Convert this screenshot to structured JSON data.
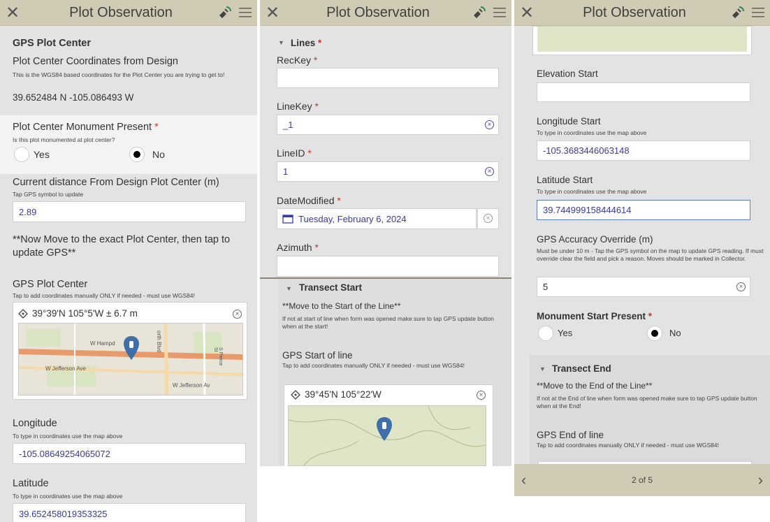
{
  "header": {
    "title": "Plot Observation"
  },
  "panel1": {
    "section_title": "GPS Plot Center",
    "design_label": "Plot Center Coordinates from Design",
    "design_help": "This is the WGS84 based coordinates for the Plot Center you are trying to get to!",
    "design_value": "39.652484 N -105.086493 W",
    "monument_label": "Plot Center Monument Present",
    "monument_help": "Is this plot monumented at plot center?",
    "monument_yes": "Yes",
    "monument_no": "No",
    "distance_label": "Current distance From Design Plot Center (m)",
    "distance_help": "Tap GPS symbol to update",
    "distance_value": "2.89",
    "instruction": "**Now Move to the exact Plot Center, then tap to update GPS**",
    "gps_label": "GPS Plot Center",
    "gps_help": "Tap to add coordinates manually ONLY if needed - must use WGS84!",
    "gps_value": "39°39'N 105°5'W ± 6.7 m",
    "map_labels": {
      "road1": "W Hampd",
      "road2": "W Jefferson Ave",
      "road3": "W Jefferson Av",
      "road4": "orth Blvd",
      "road5": "S Pierce St"
    },
    "longitude_label": "Longitude",
    "longitude_help": "To type in coordinates use the map above",
    "longitude_value": "-105.08649254065072",
    "latitude_label": "Latitude",
    "latitude_help": "To type in coordinates use the map above",
    "latitude_value": "39.652458019353325"
  },
  "panel2": {
    "lines_title": "Lines",
    "reckey_label": "RecKey",
    "reckey_value": "",
    "linekey_label": "LineKey",
    "linekey_value": "_1",
    "lineid_label": "LineID",
    "lineid_value": "1",
    "date_label": "DateModified",
    "date_value": "Tuesday, February 6, 2024",
    "azimuth_label": "Azimuth",
    "azimuth_value": "",
    "transect_title": "Transect Start",
    "move_text": "**Move to the Start of the Line**",
    "move_help": "If not at start of line when form was opened make sure to tap GPS update button when at the start!",
    "gps_start_label": "GPS Start of line",
    "gps_start_help": "Tap to add coordinates manually ONLY if needed - must use WGS84!",
    "gps_start_value": "39°45'N 105°22'W"
  },
  "panel3": {
    "elev_label": "Elevation Start",
    "elev_value": "",
    "lon_label": "Longitude Start",
    "lon_help": "To type in coordinates use the map above",
    "lon_value": "-105.3683446063148",
    "lat_label": "Latitude Start",
    "lat_help": "To type in coordinates use the map above",
    "lat_value": "39.744999158444614",
    "acc_label": "GPS Accuracy Override (m)",
    "acc_help": "Must be under 10 m - Tap the GPS symbol on the map to update GPS reading. If must override clear the field and pick a reason. Moves should be marked in Collector.",
    "acc_value": "5",
    "mon_label": "Monument Start Present",
    "mon_yes": "Yes",
    "mon_no": "No",
    "end_title": "Transect End",
    "end_move": "**Move to the End of the Line**",
    "end_help": "If not at the End of line when form was opened make sure to tap GPS update button when at the End!",
    "gps_end_label": "GPS End of line",
    "gps_end_help": "Tap to add coordinates manually ONLY if needed - must use WGS84!",
    "page_indicator": "2 of 5"
  },
  "colors": {
    "header_bg": "#cfcbb4",
    "value_text": "#3a3aa0",
    "required": "#c0392b",
    "pin": "#3f6fa8",
    "map_bg": "#dfe5c7"
  }
}
